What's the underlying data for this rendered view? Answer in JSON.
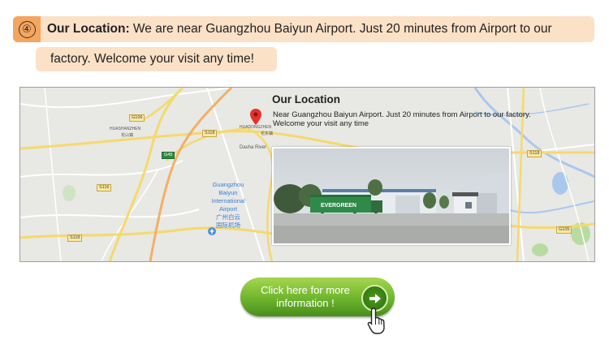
{
  "section": {
    "number": "④",
    "label": "Our Location:",
    "text_line1": " We are near Guangzhou Baiyun Airport. Just 20 minutes from Airport to our",
    "text_line2": "factory.  Welcome your visit any time!"
  },
  "map": {
    "card_title": "Our Location",
    "card_desc_line1": "Near Guangzhou Baiyun Airport. Just 20 minutes from Airport to our factory.",
    "card_desc_line2": "Welcome your visit any time",
    "place_huashanzhen": "HUASHANZHEN",
    "place_huashanzhen_cn": "花山镇",
    "place_huadongzhen": "HUADONGZHEN",
    "place_huadongzhen_cn": "花东镇",
    "river": "Dasha River",
    "airport_line1": "Guangzhou",
    "airport_line2": "Baiyun",
    "airport_line3": "International",
    "airport_line4": "Airport",
    "airport_cn_line1": "广州白云",
    "airport_cn_line2": "国际机场",
    "road_s106": "G106",
    "road_s118a": "S118",
    "road_s118b": "S118",
    "road_s118c": "S118",
    "road_s116": "S116",
    "road_g45": "G45",
    "road_s105": "G105",
    "container_text": "EVERGREEN"
  },
  "cta": {
    "line1": "Click here for more",
    "line2": "information !"
  },
  "colors": {
    "banner_bg": "#fbe1c6",
    "badge_bg": "#f5a55d",
    "button_green": "#6db52c",
    "map_bg": "#e8e8e5"
  },
  "icons": [
    "location-pin-icon",
    "arrow-right-icon",
    "hand-cursor-icon",
    "airport-icon"
  ]
}
